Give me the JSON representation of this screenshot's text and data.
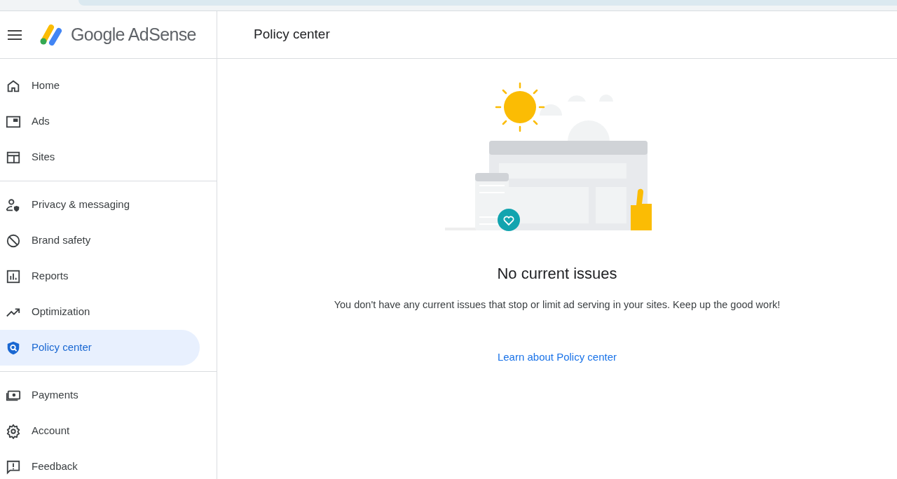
{
  "header": {
    "product": "Google AdSense",
    "page_title": "Policy center"
  },
  "sidebar": {
    "groups": [
      [
        {
          "kind": "home",
          "label": "Home",
          "selected": false
        },
        {
          "kind": "ads",
          "label": "Ads",
          "selected": false
        },
        {
          "kind": "sites",
          "label": "Sites",
          "selected": false
        }
      ],
      [
        {
          "kind": "privacy",
          "label": "Privacy & messaging",
          "selected": false
        },
        {
          "kind": "block",
          "label": "Brand safety",
          "selected": false
        },
        {
          "kind": "reports",
          "label": "Reports",
          "selected": false
        },
        {
          "kind": "trend",
          "label": "Optimization",
          "selected": false
        },
        {
          "kind": "shield",
          "label": "Policy center",
          "selected": true
        }
      ],
      [
        {
          "kind": "payments",
          "label": "Payments",
          "selected": false
        },
        {
          "kind": "gear",
          "label": "Account",
          "selected": false
        },
        {
          "kind": "feedback",
          "label": "Feedback",
          "selected": false
        }
      ]
    ]
  },
  "main": {
    "title": "No current issues",
    "message": "You don't have any current issues that stop or limit ad serving in your sites. Keep up the good work!",
    "link": "Learn about Policy center"
  }
}
